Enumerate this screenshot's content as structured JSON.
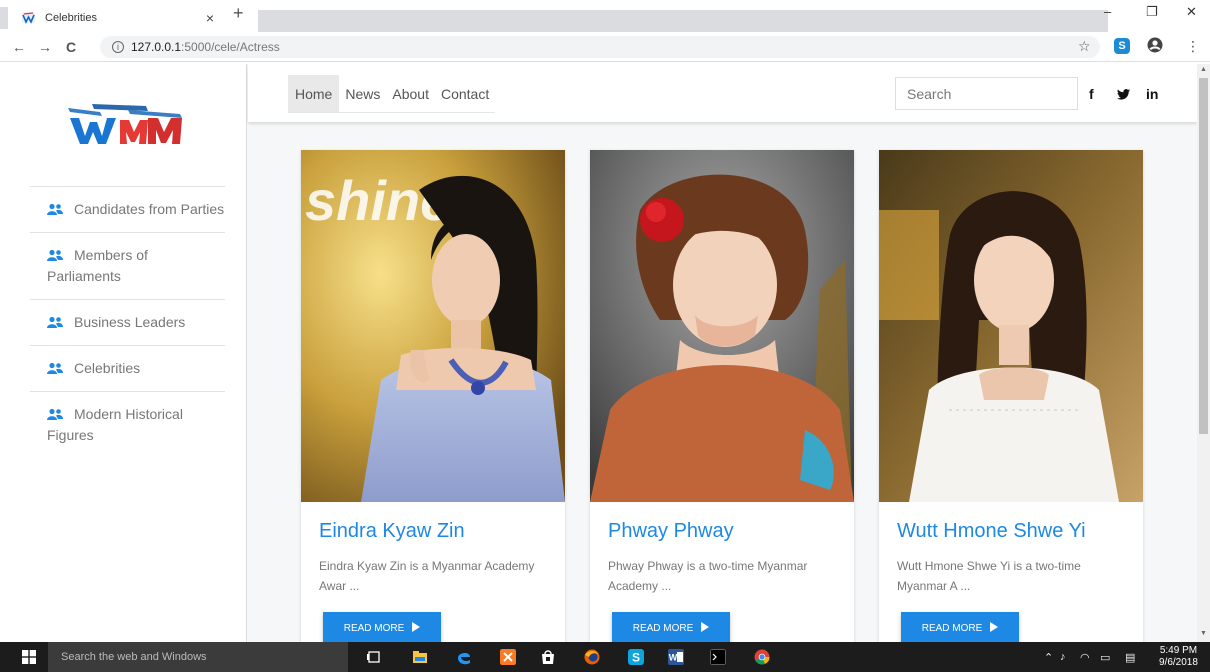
{
  "browser": {
    "tab_title": "Celebrities",
    "tab_close": "×",
    "new_tab": "+",
    "url_host": "127.0.0.1",
    "url_rest": ":5000/cele/Actress",
    "win_min": "–",
    "win_restore": "❐",
    "win_close": "✕",
    "back": "←",
    "forward": "→",
    "reload": "C",
    "star": "☆",
    "skype_label": "S",
    "menu_dots": "⋮"
  },
  "sidebar": {
    "items": [
      {
        "label": "Candidates from Parties"
      },
      {
        "label": "Members of Parliaments"
      },
      {
        "label": "Business Leaders"
      },
      {
        "label": "Celebrities"
      },
      {
        "label": "Modern Historical Figures"
      }
    ]
  },
  "nav": {
    "items": [
      "Home",
      "News",
      "About",
      "Contact"
    ],
    "search_placeholder": "Search",
    "social": [
      "f",
      "t",
      "in"
    ]
  },
  "cards": [
    {
      "name": "Eindra Kyaw Zin",
      "desc": "Eindra Kyaw Zin is a Myanmar Academy Awar ...",
      "button": "READ MORE"
    },
    {
      "name": "Phway Phway",
      "desc": "Phway Phway is a two-time Myanmar Academy ...",
      "button": "READ MORE"
    },
    {
      "name": "Wutt Hmone Shwe Yi",
      "desc": "Wutt Hmone Shwe Yi is a two-time Myanmar A ...",
      "button": "READ MORE"
    }
  ],
  "taskbar": {
    "search_placeholder": "Search the web and Windows",
    "time": "5:49 PM",
    "date": "9/6/2018"
  },
  "colors": {
    "accent": "#1e88e5",
    "sidebar_icon": "#1e88e5",
    "taskbar": "#1c1c1c"
  }
}
